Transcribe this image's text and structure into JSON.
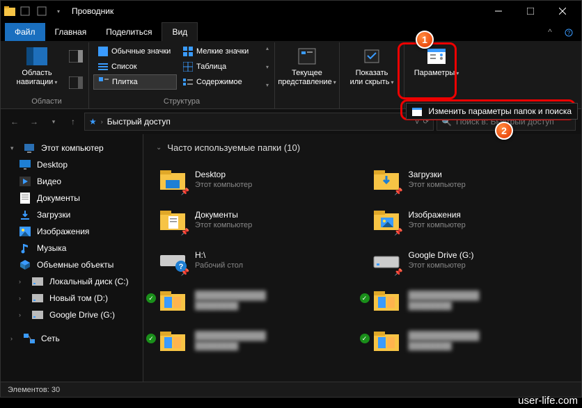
{
  "titlebar": {
    "title": "Проводник"
  },
  "tabs": {
    "file": "Файл",
    "home": "Главная",
    "share": "Поделиться",
    "view": "Вид"
  },
  "ribbon": {
    "nav_pane": "Область\nнавигации",
    "layouts": {
      "normal": "Обычные значки",
      "small": "Мелкие значки",
      "list": "Список",
      "table": "Таблица",
      "tiles": "Плитка",
      "content": "Содержимое"
    },
    "group_panes": "Области",
    "group_layout": "Структура",
    "current_view": "Текущее\nпредставление",
    "show_hide": "Показать\nили скрыть",
    "options": "Параметры",
    "tooltip_options": "Изменить параметры папок и поиска"
  },
  "markers": {
    "one": "1",
    "two": "2"
  },
  "addr": {
    "quick_access": "Быстрый доступ",
    "search_placeholder": "Поиск в: Быстрый доступ"
  },
  "sidebar": {
    "this_pc": "Этот компьютер",
    "desktop": "Desktop",
    "videos": "Видео",
    "documents": "Документы",
    "downloads": "Загрузки",
    "pictures": "Изображения",
    "music": "Музыка",
    "objects3d": "Объемные объекты",
    "local_c": "Локальный диск (C:)",
    "new_d": "Новый том (D:)",
    "gdrive": "Google Drive (G:)",
    "network": "Сеть"
  },
  "content": {
    "group_title": "Часто используемые папки (10)",
    "items": [
      {
        "name": "Desktop",
        "sub": "Этот компьютер",
        "icon": "folder-desktop",
        "pin": true
      },
      {
        "name": "Загрузки",
        "sub": "Этот компьютер",
        "icon": "folder-downloads",
        "pin": true
      },
      {
        "name": "Документы",
        "sub": "Этот компьютер",
        "icon": "folder-docs",
        "pin": true
      },
      {
        "name": "Изображения",
        "sub": "Этот компьютер",
        "icon": "folder-pics",
        "pin": true
      },
      {
        "name": "H:\\",
        "sub": "Рабочий стол",
        "icon": "drive-q",
        "pin": true
      },
      {
        "name": "Google Drive (G:)",
        "sub": "Этот компьютер",
        "icon": "drive",
        "pin": true
      },
      {
        "name": "blur1",
        "sub": "blur",
        "icon": "folder-thumb",
        "blur": true,
        "check": true
      },
      {
        "name": "blur2",
        "sub": "blur",
        "icon": "folder-thumb",
        "blur": true,
        "check": true
      },
      {
        "name": "blur3",
        "sub": "blur",
        "icon": "folder-thumb",
        "blur": true,
        "check": true
      },
      {
        "name": "blur4",
        "sub": "blur",
        "icon": "folder-thumb",
        "blur": true,
        "check": true
      }
    ]
  },
  "statusbar": {
    "elements": "Элементов: 30"
  },
  "watermark": "user-life.com"
}
